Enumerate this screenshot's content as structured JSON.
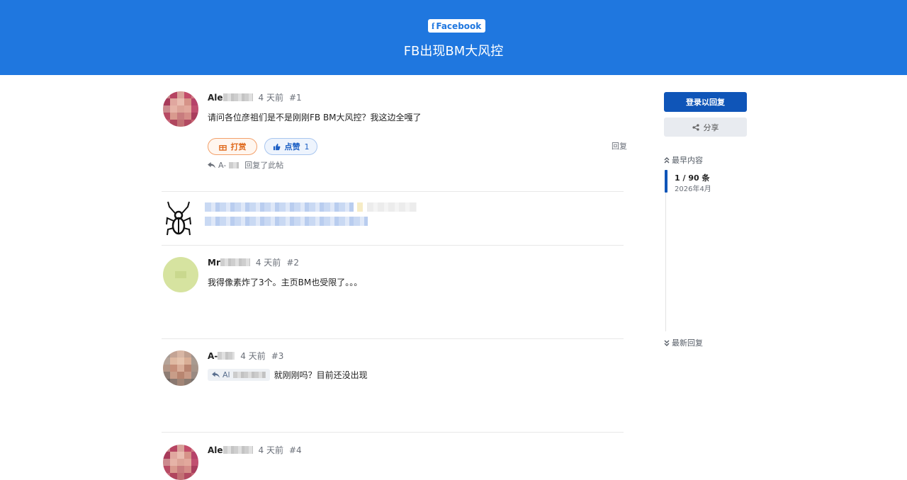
{
  "header": {
    "category_tag": "Facebook",
    "tag_icon": "f",
    "title": "FB出现BM大风控"
  },
  "posts": [
    {
      "username_prefix": "Ale",
      "date": "4 天前",
      "number": "#1",
      "content": "请问各位彦祖们是不是刚刚FB BM大风控？我这边全嘎了",
      "tip_label": "打赏",
      "like_label": "点赞",
      "like_count": "1",
      "reply_label": "回复",
      "replied_by_prefix": "A-",
      "replied_text": "回复了此帖"
    },
    {
      "username_prefix": "Mr",
      "date": "4 天前",
      "number": "#2",
      "content": "我得像素炸了3个。主页BM也受限了。。。"
    },
    {
      "username_prefix": "A-",
      "date": "4 天前",
      "number": "#3",
      "quote_prefix": "Al",
      "content": "就刚刚吗？目前还没出现"
    },
    {
      "username_prefix": "Ale",
      "date": "4 天前",
      "number": "#4"
    }
  ],
  "sidebar": {
    "login_label": "登录以回复",
    "share_label": "分享",
    "oldest_label": "最早内容",
    "progress_text": "1 / 90 条",
    "progress_date": "2026年4月",
    "newest_label": "最新回复"
  },
  "colors": {
    "brand": "#1f77df",
    "primary": "#0f55b8",
    "tip": "#e06b1f"
  },
  "icons": {
    "gift": "gift-icon",
    "thumb": "thumbs-up-icon",
    "reply": "reply-icon",
    "share": "share-icon",
    "up": "double-chevron-up-icon",
    "down": "double-chevron-down-icon"
  }
}
